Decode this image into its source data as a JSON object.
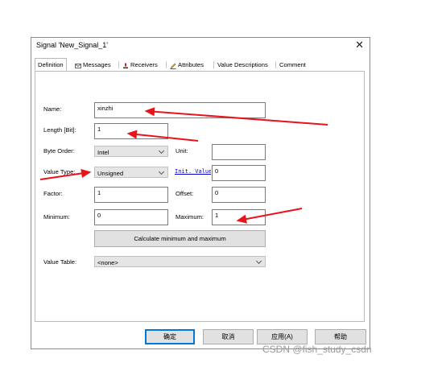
{
  "window": {
    "title": "Signal 'New_Signal_1'"
  },
  "tabs": [
    {
      "label": "Definition",
      "active": true
    },
    {
      "label": "Messages",
      "icon": "envelope-icon"
    },
    {
      "label": "Receivers",
      "icon": "receiver-icon"
    },
    {
      "label": "Attributes",
      "icon": "pencil-icon"
    },
    {
      "label": "Value Descriptions"
    },
    {
      "label": "Comment"
    }
  ],
  "form": {
    "name_label": "Name:",
    "name_value": "xinzhi",
    "length_label": "Length [Bit]:",
    "length_value": "1",
    "byte_order_label": "Byte Order:",
    "byte_order_value": "Intel",
    "unit_label": "Unit:",
    "unit_value": "",
    "value_type_label": "Value Type:",
    "value_type_value": "Unsigned",
    "init_value_link": "Init. Value",
    "init_value": "0",
    "factor_label": "Factor:",
    "factor_value": "1",
    "offset_label": "Offset:",
    "offset_value": "0",
    "minimum_label": "Minimum:",
    "minimum_value": "0",
    "maximum_label": "Maximum:",
    "maximum_value": "1",
    "calc_button": "Calculate minimum and maximum",
    "value_table_label": "Value Table:",
    "value_table_value": "<none>"
  },
  "buttons": {
    "ok": "确定",
    "cancel": "取消",
    "apply": "应用(A)",
    "help": "帮助"
  },
  "watermark": "CSDN @fish_study_csdn",
  "colors": {
    "annotation_arrow": "#e8141a",
    "focus_border": "#0078d7",
    "link": "#0000cc"
  }
}
